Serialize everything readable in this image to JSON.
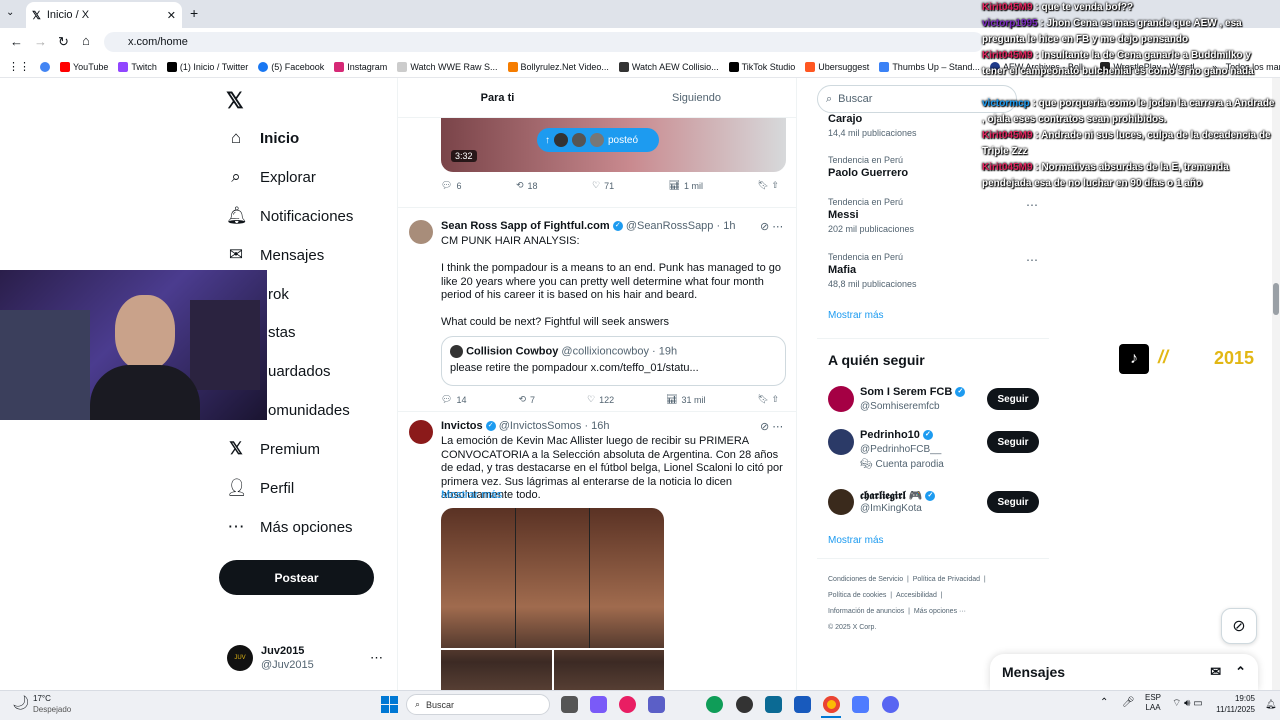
{
  "browser": {
    "tab_title": "Inicio / X",
    "url": "x.com/home",
    "bookmarks": [
      "YouTube",
      "Twitch",
      "(1) Inicio / Twitter",
      "(5) Facebook",
      "Instagram",
      "Watch WWE Raw S...",
      "Bollyrulez.Net Video...",
      "Watch AEW Collisio...",
      "TikTok Studio",
      "Ubersuggest",
      "Thumbs Up – Stand...",
      "AEW Archives - Boll...",
      "WrestlePlay - Wrestl..."
    ],
    "all_bookmarks": "Todos los marcadores"
  },
  "nav": {
    "items": [
      "Inicio",
      "Explorar",
      "Notificaciones",
      "Mensajes",
      "Grok",
      "Listas",
      "Guardados",
      "Comunidades",
      "Premium",
      "Perfil",
      "Más opciones"
    ],
    "visible_partial": [
      "rok",
      "stas",
      "uardados",
      "omunidades"
    ],
    "post_label": "Postear",
    "account_name": "Juv2015",
    "account_handle": "@Juv2015"
  },
  "feed": {
    "tabs": [
      "Para ti",
      "Siguiendo"
    ],
    "video_duration": "3:32",
    "posted_pill": "posteó",
    "tweet1_stats": {
      "replies": "6",
      "retweets": "18",
      "likes": "71",
      "views": "1 mil"
    },
    "tweet2": {
      "author": "Sean Ross Sapp of Fightful.com",
      "handle": "@SeanRossSapp · 1h",
      "line1": "CM PUNK HAIR ANALYSIS:",
      "line2": "I think the pompadour is a means to an end. Punk has managed to go like 20 years where you can pretty well determine what four month period of his career it is based on his hair and beard.",
      "line3": "What could be next? Fightful will seek answers",
      "quote_author": "Collision Cowboy",
      "quote_handle": "@collixioncowboy · 19h",
      "quote_text": "please retire the pompadour x.com/teffo_01/statu...",
      "stats": {
        "replies": "14",
        "retweets": "7",
        "likes": "122",
        "views": "31 mil"
      }
    },
    "tweet3": {
      "author": "Invictos",
      "handle": "@InvictosSomos · 16h",
      "text": "La emoción de Kevin Mac Allister luego de recibir su PRIMERA CONVOCATORIA a la Selección absoluta de Argentina. Con 28 años de edad, y tras destacarse en el fútbol belga, Lionel Scaloni lo citó por primera vez. Sus lágrimas al enterarse de la noticia lo dicen absolutamente todo.",
      "more": "Mostrar más"
    }
  },
  "sidebar": {
    "search_placeholder": "Buscar",
    "trends": [
      {
        "context": "",
        "name": "Carajo",
        "count": "14,4 mil publicaciones"
      },
      {
        "context": "Tendencia en Perú",
        "name": "Paolo Guerrero",
        "count": ""
      },
      {
        "context": "Tendencia en Perú",
        "name": "Messi",
        "count": "202 mil publicaciones"
      },
      {
        "context": "Tendencia en Perú",
        "name": "Mafia",
        "count": "48,8 mil publicaciones"
      }
    ],
    "show_more": "Mostrar más",
    "who_to_follow_title": "A quién seguir",
    "follow": [
      {
        "name": "Som I Serem FCB",
        "handle": "@Somhiseremfcb",
        "extra": ""
      },
      {
        "name": "Pedrinho10",
        "handle": "@PedrinhoFCB__",
        "extra": "Cuenta parodia"
      },
      {
        "name": "𝖈𝖍𝖆𝖗𝖑𝖎𝖊𝖌𝖎𝖗𝖑 🎮",
        "handle": "@ImKingKota",
        "extra": ""
      }
    ],
    "follow_label": "Seguir",
    "footer": [
      "Condiciones de Servicio",
      "Política de Privacidad",
      "Política de cookies",
      "Accesibilidad",
      "Información de anuncios",
      "Más opciones ···",
      "© 2025 X Corp."
    ],
    "messages_label": "Mensajes"
  },
  "chat": [
    {
      "user": "Kirit045M9",
      "msg": " : que te venda bof??"
    },
    {
      "user": "victorp1995",
      "msg": " : Jhon Cena es mas grande que AEW , esa pregunta le hice en FB y me dejo pensando"
    },
    {
      "user": "Kirit045M9",
      "msg": " : Insultante la de Cena ganarle a Buddmilko y tener el campeonato bulchenial es como si no gano nada"
    },
    {
      "user": "victormcp",
      "msg": " : que porqueria como le joden la carrera a Andrade , ojala eses contratos sean prohibidos."
    },
    {
      "user": "Kirit045M9",
      "msg": " : Andrade ni sus luces, culpa de la decadencia de Triple Zzz"
    },
    {
      "user": "Kirit045M9",
      "msg": " : Normativas absurdas de la E, tremenda pendejada esa de no luchar en 90 días o 1 año"
    }
  ],
  "overlay_year": "2015",
  "taskbar": {
    "weather_temp": "17°C",
    "weather_desc": "Despejado",
    "search": "Buscar",
    "lang": "ESP",
    "lang2": "LAA",
    "time": "19:05",
    "date": "11/11/2025"
  }
}
